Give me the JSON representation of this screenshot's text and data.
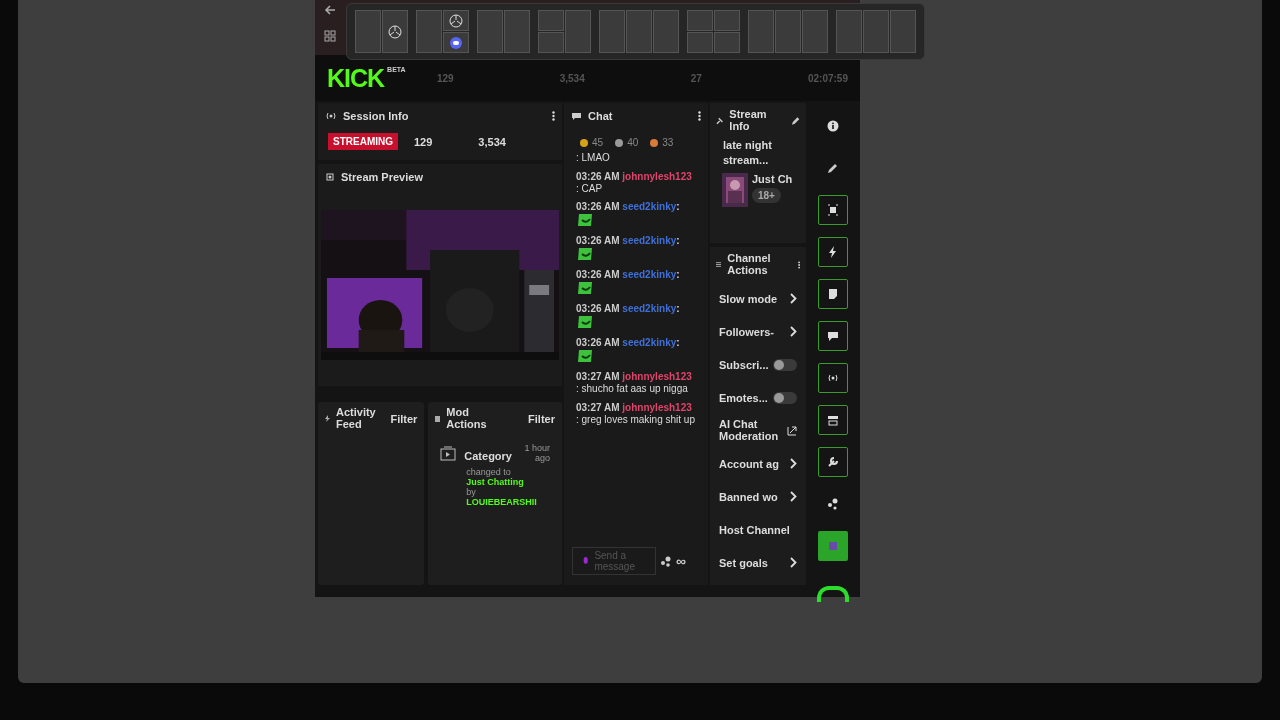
{
  "header": {
    "logo": "KICK",
    "badge": "BETA",
    "stats": [
      "129",
      "3,534",
      "27",
      "02:07:59"
    ]
  },
  "session_info": {
    "title": "Session Info",
    "status": "STREAMING",
    "viewers": "129",
    "followers": "3,534"
  },
  "stream_preview": {
    "title": "Stream Preview"
  },
  "activity_feed": {
    "title": "Activity Feed",
    "filter": "Filter"
  },
  "mod_actions": {
    "title": "Mod Actions",
    "filter": "Filter",
    "entries": [
      {
        "title": "Category",
        "time": "1 hour ago",
        "detail": "changed to",
        "value": "Just Chatting",
        "by": "by",
        "user": "LOUIEBEARSHII"
      }
    ]
  },
  "chat": {
    "title": "Chat",
    "counts": [
      {
        "value": "45",
        "color": "#d4a017"
      },
      {
        "value": "40",
        "color": "#9a9a9a"
      },
      {
        "value": "33",
        "color": "#d77a3a"
      }
    ],
    "messages": [
      {
        "kind": "text",
        "text": ": LMAO"
      },
      {
        "kind": "text",
        "time": "03:26 AM",
        "user": "johnnylesh123",
        "color": "#e0436b",
        "text": ": CAP"
      },
      {
        "kind": "emote",
        "time": "03:26 AM",
        "user": "seed2kinky",
        "color": "#3f6fd8",
        "text": ":"
      },
      {
        "kind": "emote",
        "time": "03:26 AM",
        "user": "seed2kinky",
        "color": "#3f6fd8",
        "text": ":"
      },
      {
        "kind": "emote",
        "time": "03:26 AM",
        "user": "seed2kinky",
        "color": "#3f6fd8",
        "text": ":"
      },
      {
        "kind": "emote",
        "time": "03:26 AM",
        "user": "seed2kinky",
        "color": "#3f6fd8",
        "text": ":"
      },
      {
        "kind": "emote",
        "time": "03:26 AM",
        "user": "seed2kinky",
        "color": "#3f6fd8",
        "text": ":"
      },
      {
        "kind": "text",
        "time": "03:27 AM",
        "user": "johnnylesh123",
        "color": "#e0436b",
        "text": ": shucho fat aas up nigga"
      },
      {
        "kind": "text",
        "time": "03:27 AM",
        "user": "johnnylesh123",
        "color": "#e0436b",
        "text": ": greg loves making shit up"
      }
    ],
    "placeholder": "Send a message",
    "infinity": "∞"
  },
  "stream_info": {
    "title": "Stream Info",
    "stream_title": "late night stream...",
    "category": "Just Ch",
    "rating": "18+"
  },
  "channel_actions": {
    "title": "Channel Actions",
    "items": [
      {
        "label": "Slow mode",
        "kind": "link"
      },
      {
        "label": "Followers-",
        "kind": "link"
      },
      {
        "label": "Subscri...",
        "kind": "toggle",
        "on": false
      },
      {
        "label": "Emotes...",
        "kind": "toggle",
        "on": false
      },
      {
        "label": "AI Chat Moderation",
        "kind": "external"
      },
      {
        "label": "Account ag",
        "kind": "link"
      },
      {
        "label": "Banned wo",
        "kind": "link"
      },
      {
        "label": "Host Channel",
        "kind": "plain"
      },
      {
        "label": "Set goals",
        "kind": "link"
      }
    ]
  },
  "rail": [
    {
      "kind": "info",
      "outlined": false
    },
    {
      "kind": "pencil",
      "outlined": false
    },
    {
      "kind": "camera",
      "outlined": true
    },
    {
      "kind": "bolt",
      "outlined": true
    },
    {
      "kind": "note",
      "outlined": true
    },
    {
      "kind": "chat",
      "outlined": true
    },
    {
      "kind": "broadcast",
      "outlined": true
    },
    {
      "kind": "video",
      "outlined": true
    },
    {
      "kind": "wrench",
      "outlined": true
    },
    {
      "kind": "dots",
      "outlined": false
    },
    {
      "kind": "app",
      "outlined": false
    }
  ]
}
